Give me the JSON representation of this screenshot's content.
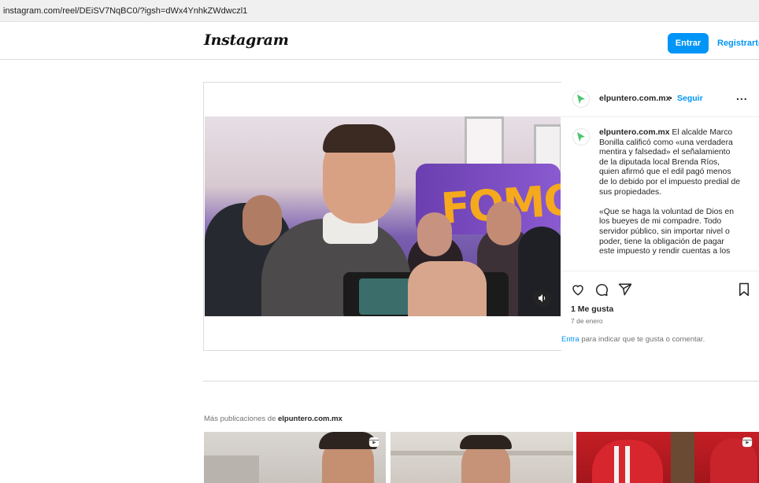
{
  "browser": {
    "url": "instagram.com/reel/DEiSV7NqBC0/?igsh=dWx4YnhkZWdwczl1"
  },
  "nav": {
    "logo": "Instagram",
    "login_label": "Entrar",
    "register_label": "Registrarte"
  },
  "post": {
    "account": "elpuntero.com.mx",
    "separator": "•",
    "follow_label": "Seguir",
    "more_label": "...",
    "caption_account": "elpuntero.com.mx",
    "caption_p1": " El alcalde Marco Bonilla calificó como «una verdadera mentira y falsedad» el señalamiento de la diputada local Brenda Ríos, quien afirmó que el edil pagó menos de lo debido por el impuesto predial de sus propiedades.",
    "caption_p2": "«Que se haga la voluntad de Dios en los bueyes de mi compadre. Todo servidor público, sin importar nivel o poder, tiene la obligación de pagar este impuesto y rendir cuentas a los",
    "likes": "1 Me gusta",
    "date": "7 de enero",
    "login_link": "Entra",
    "login_prompt": " para indicar que te gusta o comentar."
  },
  "more_posts": {
    "prefix": "Más publicaciones de ",
    "account": "elpuntero.com.mx"
  },
  "icons": {
    "heart": "heart-icon",
    "comment": "comment-icon",
    "share": "share-icon",
    "bookmark": "bookmark-icon",
    "mute": "mute-icon",
    "reel": "reel-icon"
  },
  "colors": {
    "accent": "#0095f6",
    "text": "#262626",
    "muted": "#737373",
    "border": "#dbdbdb"
  }
}
